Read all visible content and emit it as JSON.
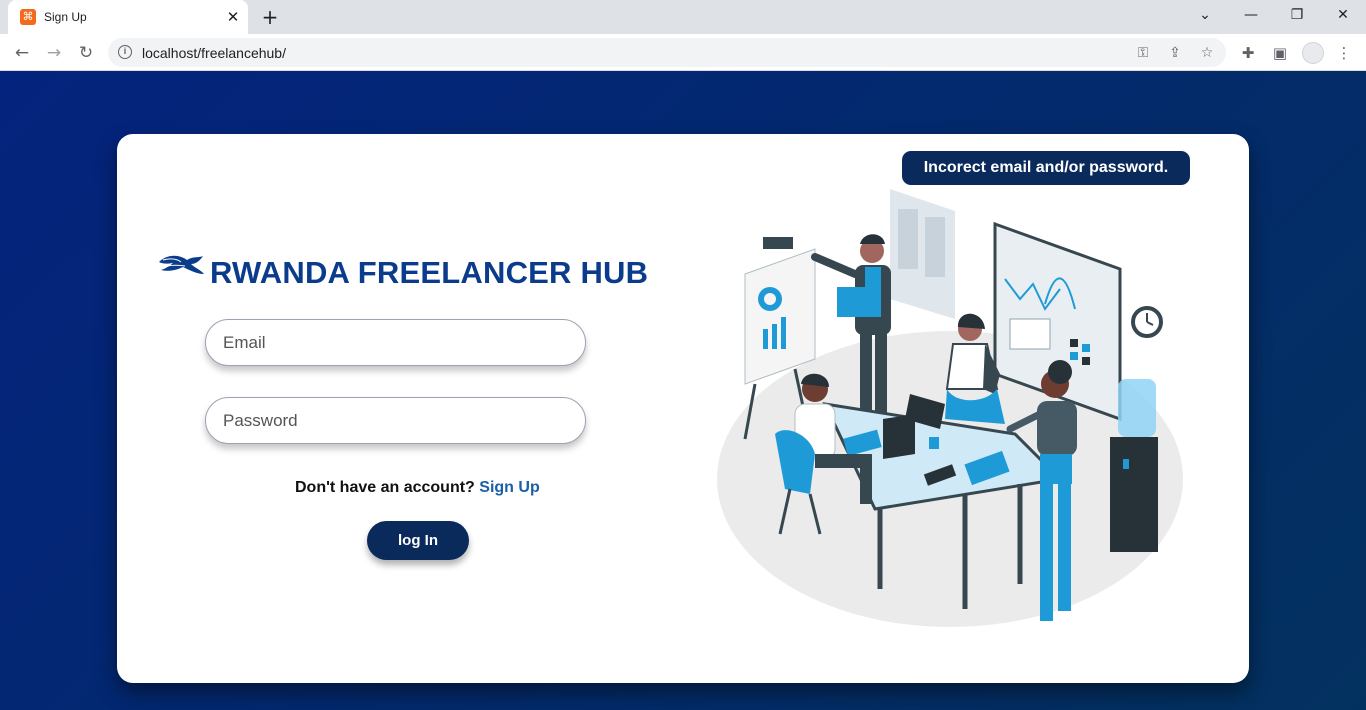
{
  "browser": {
    "tab_title": "Sign Up",
    "url": "localhost/freelancehub/"
  },
  "app": {
    "brand_name": "RWANDA FREELANCER HUB",
    "alert": "Incorect email and/or password.",
    "email_placeholder": "Email",
    "password_placeholder": "Password",
    "signup_prompt": "Don't have an account?",
    "signup_link": "Sign Up",
    "login_button": "log In"
  },
  "colors": {
    "brand": "#0b3c8c",
    "button": "#0a2a5c",
    "link": "#1a5fa8",
    "background": "#04237e"
  }
}
